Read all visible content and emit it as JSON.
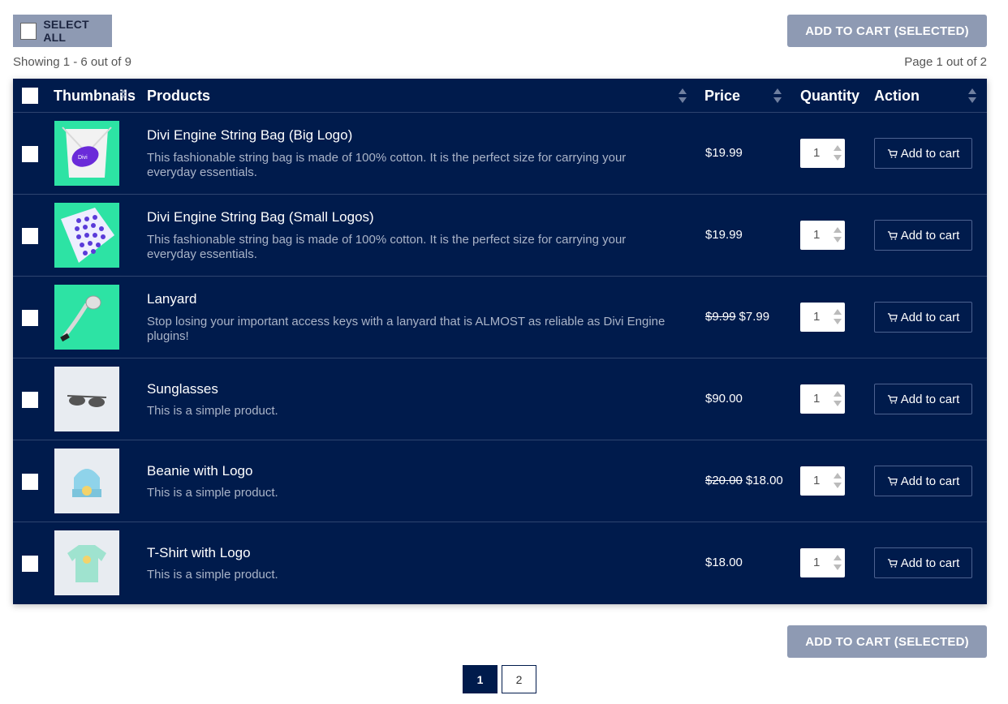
{
  "toolbar": {
    "select_all_label": "SELECT ALL",
    "add_selected_label": "ADD TO CART (SELECTED)",
    "showing_text": "Showing 1 - 6 out of 9",
    "page_text": "Page 1 out of 2"
  },
  "columns": {
    "thumbnails": "Thumbnails",
    "products": "Products",
    "price": "Price",
    "quantity": "Quantity",
    "action": "Action"
  },
  "products": [
    {
      "title": "Divi Engine String Bag (Big Logo)",
      "desc": "This fashionable string bag is made of 100% cotton. It is the perfect size for carrying your everyday essentials.",
      "old_price": "",
      "price": "$19.99",
      "qty": "1",
      "action": "Add to cart"
    },
    {
      "title": "Divi Engine String Bag (Small Logos)",
      "desc": "This fashionable string bag is made of 100% cotton. It is the perfect size for carrying your everyday essentials.",
      "old_price": "",
      "price": "$19.99",
      "qty": "1",
      "action": "Add to cart"
    },
    {
      "title": "Lanyard",
      "desc": "Stop losing your important access keys with a lanyard that is ALMOST as reliable as Divi Engine plugins!",
      "old_price": "$9.99",
      "price": "$7.99",
      "qty": "1",
      "action": "Add to cart"
    },
    {
      "title": "Sunglasses",
      "desc": "This is a simple product.",
      "old_price": "",
      "price": "$90.00",
      "qty": "1",
      "action": "Add to cart"
    },
    {
      "title": "Beanie with Logo",
      "desc": "This is a simple product.",
      "old_price": "$20.00",
      "price": "$18.00",
      "qty": "1",
      "action": "Add to cart"
    },
    {
      "title": "T-Shirt with Logo",
      "desc": "This is a simple product.",
      "old_price": "",
      "price": "$18.00",
      "qty": "1",
      "action": "Add to cart"
    }
  ],
  "pagination": {
    "page1": "1",
    "page2": "2"
  },
  "colors": {
    "table_bg": "#001b4c",
    "button_bg": "#8e9ab3",
    "accent_green": "#2de3a4"
  }
}
